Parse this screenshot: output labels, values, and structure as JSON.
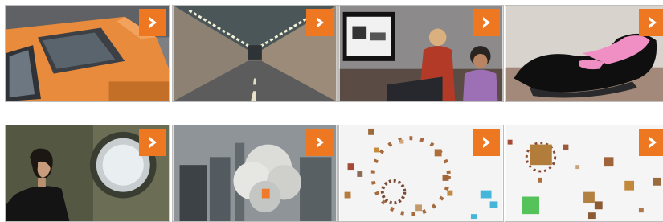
{
  "colors": {
    "play_badge": "#ee7722",
    "play_glyph": "#ffffff",
    "page_background": "#ffffff"
  },
  "thumbnails": [
    {
      "name": "yellow-taxi-thumbnail",
      "icon": "play-arrow-icon"
    },
    {
      "name": "tunnel-road-thumbnail",
      "icon": "play-arrow-icon"
    },
    {
      "name": "people-watching-screen-thumbnail",
      "icon": "play-arrow-icon"
    },
    {
      "name": "black-lounge-chair-thumbnail",
      "icon": "play-arrow-icon"
    },
    {
      "name": "woman-by-porthole-thumbnail",
      "icon": "play-arrow-icon"
    },
    {
      "name": "city-smoke-thumbnail",
      "icon": "play-arrow-icon"
    },
    {
      "name": "circular-dots-pattern-thumbnail",
      "icon": "play-arrow-icon"
    },
    {
      "name": "scattered-squares-pattern-thumbnail",
      "icon": "play-arrow-icon"
    }
  ]
}
